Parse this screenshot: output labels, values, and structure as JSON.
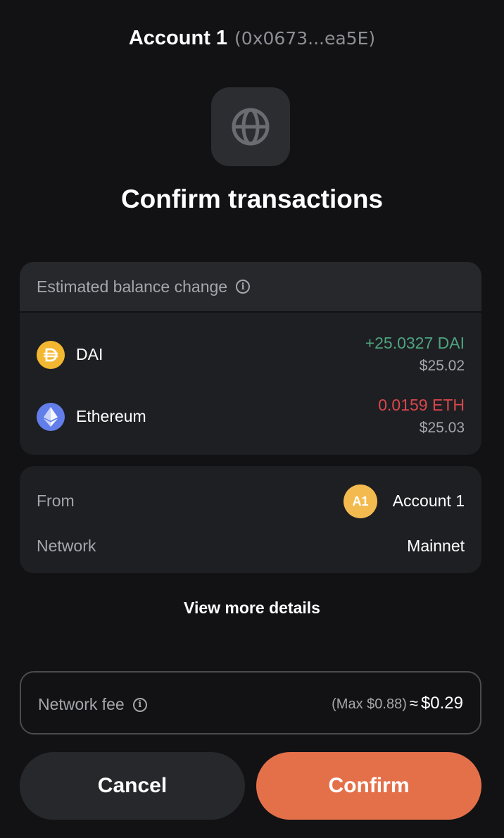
{
  "header": {
    "account_name": "Account 1",
    "address": "(0x0673...ea5E)"
  },
  "site_icon": "globe-icon",
  "title": "Confirm transactions",
  "balance_change": {
    "heading": "Estimated balance change",
    "tokens": [
      {
        "name": "DAI",
        "icon": "dai-icon",
        "amount": "+25.0327 DAI",
        "usd": "$25.02",
        "amount_color": "#4fa37e"
      },
      {
        "name": "Ethereum",
        "icon": "ethereum-icon",
        "amount": "0.0159 ETH",
        "usd": "$25.03",
        "amount_color": "#d9474b"
      }
    ]
  },
  "details": {
    "from_label": "From",
    "from_avatar": "A1",
    "from_value": "Account 1",
    "network_label": "Network",
    "network_value": "Mainnet"
  },
  "view_more": "View more details",
  "fee": {
    "label": "Network fee",
    "max": "(Max $0.88)",
    "approx": "≈",
    "value": "$0.29"
  },
  "buttons": {
    "cancel": "Cancel",
    "confirm": "Confirm"
  },
  "colors": {
    "background": "#121215",
    "accent": "#e4704a",
    "positive": "#4fa37e",
    "negative": "#d9474b"
  }
}
